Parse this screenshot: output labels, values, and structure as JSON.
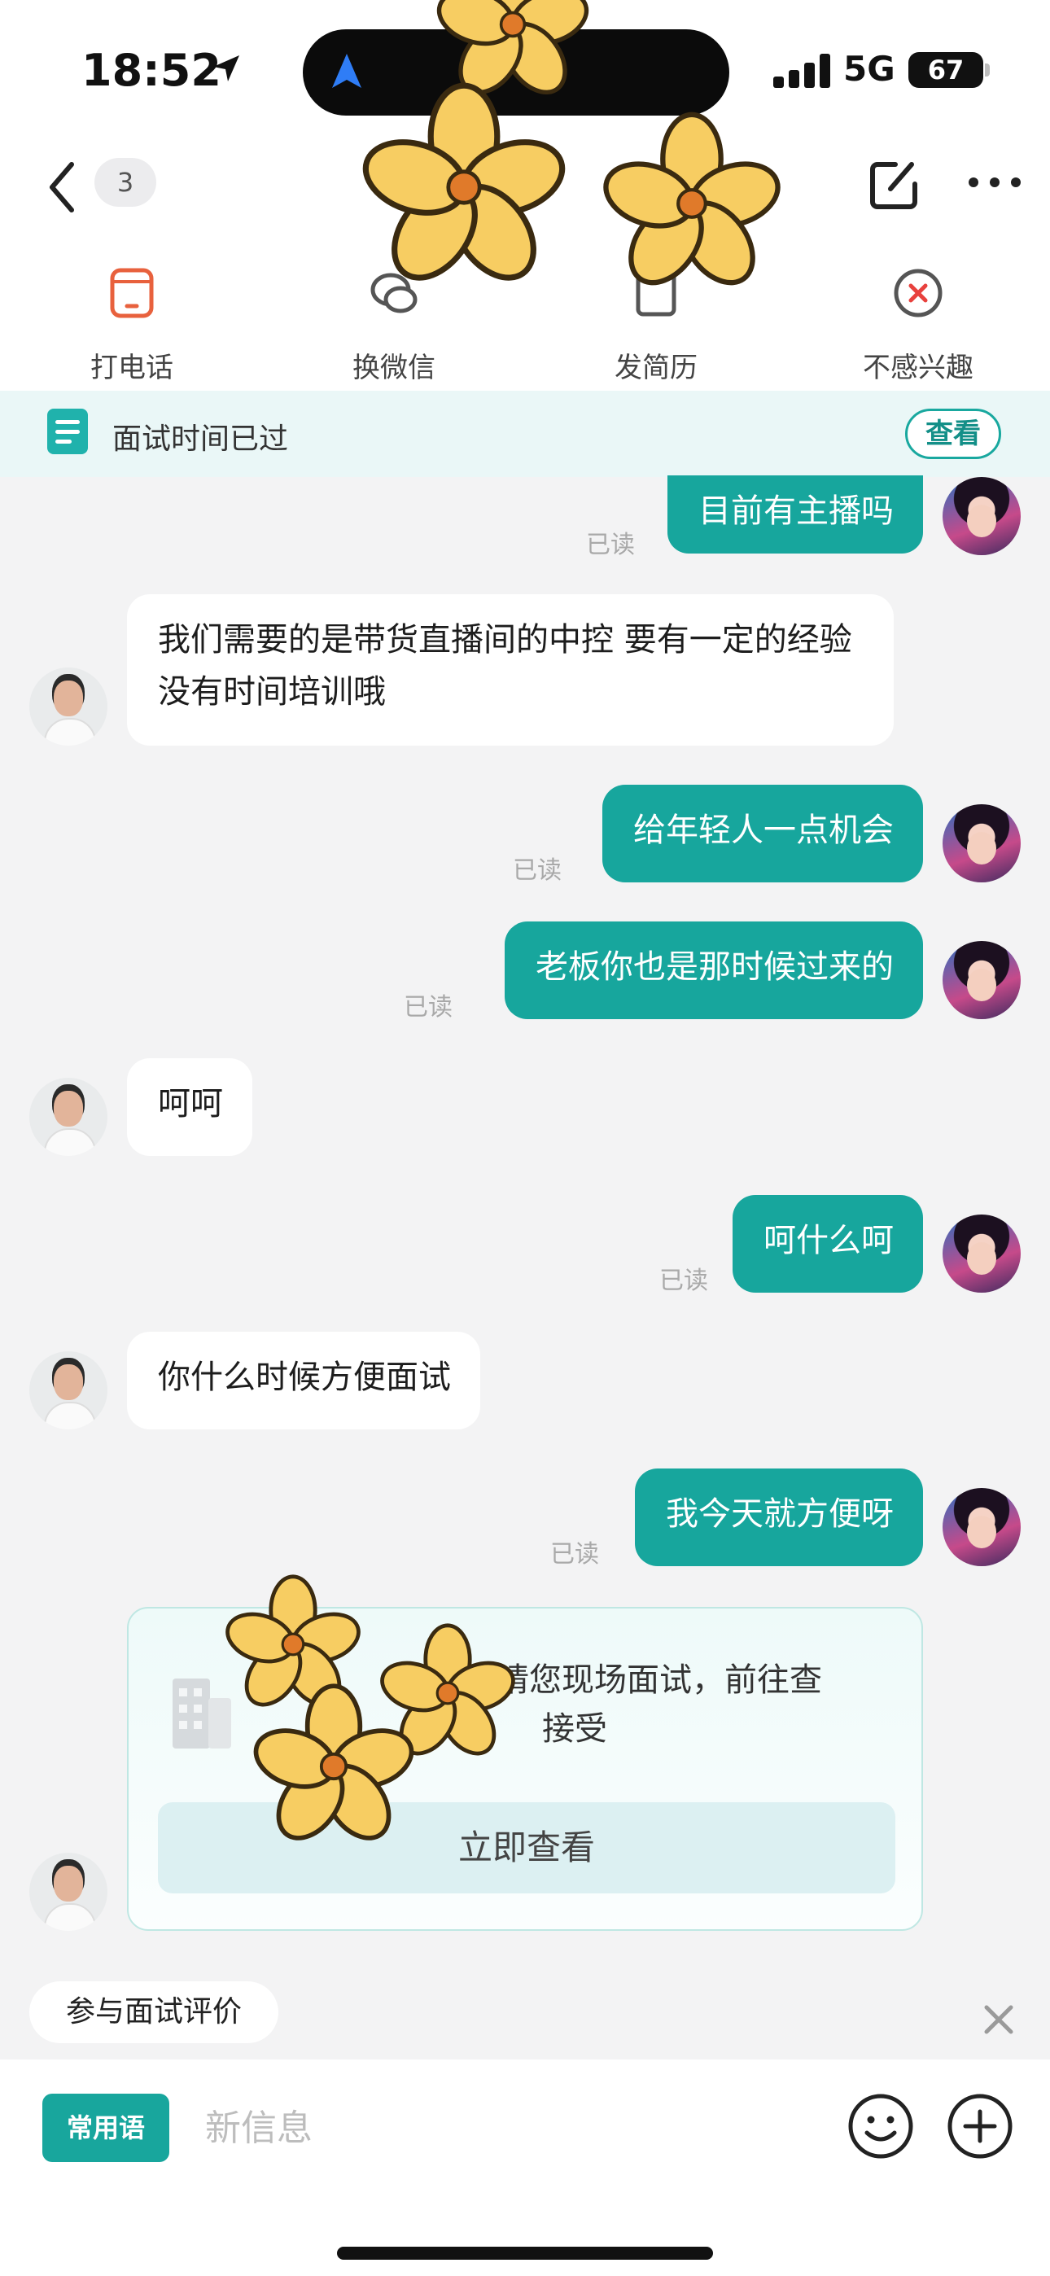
{
  "status_bar": {
    "time": "18:52",
    "network": "5G",
    "battery": "67"
  },
  "nav": {
    "unread_count": "3"
  },
  "actions": [
    {
      "label": "打电话",
      "icon": "phone-icon"
    },
    {
      "label": "换微信",
      "icon": "wechat-icon"
    },
    {
      "label": "发简历",
      "icon": "resume-icon"
    },
    {
      "label": "不感兴趣",
      "icon": "not-interested-icon"
    }
  ],
  "banner": {
    "text": "面试时间已过",
    "button": "查看"
  },
  "messages": [
    {
      "from": "me",
      "text": "目前有主播吗",
      "status": "已读"
    },
    {
      "from": "them",
      "text": "我们需要的是带货直播间的中控 要有一定的经验 没有时间培训哦"
    },
    {
      "from": "me",
      "text": "给年轻人一点机会",
      "status": "已读"
    },
    {
      "from": "me",
      "text": "老板你也是那时候过来的",
      "status": "已读"
    },
    {
      "from": "them",
      "text": "呵呵"
    },
    {
      "from": "me",
      "text": "呵什么呵",
      "status": "已读"
    },
    {
      "from": "them",
      "text": "你什么时候方便面试"
    },
    {
      "from": "me",
      "text": "我今天就方便呀",
      "status": "已读"
    }
  ],
  "invite_card": {
    "text": "邀请您现场面试，前往查",
    "text_line2": "接受",
    "button": "立即查看"
  },
  "review_chip": "参与面试评价",
  "input": {
    "phrases_label": "常用语",
    "placeholder": "新信息"
  },
  "colors": {
    "accent": "#17a69d",
    "banner_bg": "#eaf7f7",
    "chat_bg": "#f3f3f4"
  }
}
